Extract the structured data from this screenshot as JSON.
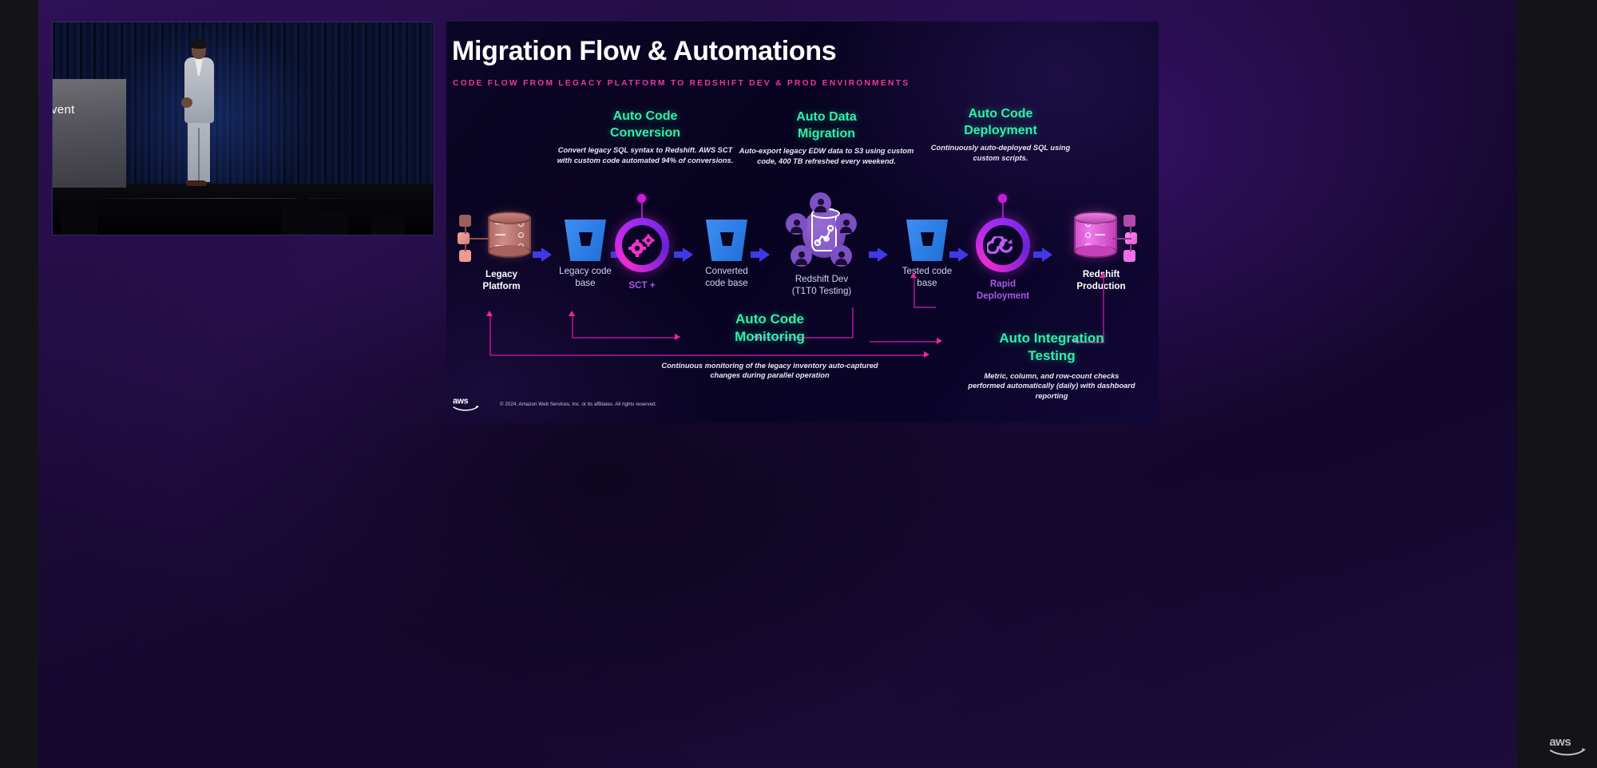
{
  "slide": {
    "title": "Migration Flow & Automations",
    "subtitle": "CODE FLOW FROM LEGACY PLATFORM TO REDSHIFT DEV & PROD ENVIRONMENTS",
    "footer": {
      "brand": "aws",
      "copyright": "© 2024, Amazon Web Services, Inc. or its affiliates. All rights reserved."
    }
  },
  "video": {
    "podium_text": "vent"
  },
  "watermark": {
    "brand": "aws"
  },
  "blocks": [
    {
      "id": "auto-code-conversion",
      "heading_line1": "Auto Code",
      "heading_line2": "Conversion",
      "description": "Convert legacy SQL syntax to Redshift. AWS SCT with custom code automated 94% of conversions.",
      "color": "#2ff0a8"
    },
    {
      "id": "auto-data-migration",
      "heading_line1": "Auto Data",
      "heading_line2": "Migration",
      "description": "Auto-export legacy EDW data to S3 using custom code, 400 TB refreshed every weekend.",
      "color": "#2ff0a8"
    },
    {
      "id": "auto-code-deployment",
      "heading_line1": "Auto Code",
      "heading_line2": "Deployment",
      "description": "Continuously auto-deployed SQL using custom scripts.",
      "color": "#2ff0a8"
    },
    {
      "id": "auto-code-monitoring",
      "heading_line1": "Auto Code",
      "heading_line2": "Monitoring",
      "description": "Continuous monitoring of the legacy inventory auto-captured changes during parallel operation",
      "color": "#2ff0a8"
    },
    {
      "id": "auto-integration-testing",
      "heading_line1": "Auto Integration",
      "heading_line2": "Testing",
      "description": "Metric, column, and row-count checks performed automatically (daily) with dashboard reporting",
      "color": "#2ff0a8"
    }
  ],
  "flow": {
    "nodes": [
      {
        "id": "legacy-platform",
        "label_line1": "Legacy",
        "label_line2": "Platform",
        "icon": "database-icon",
        "style": "white"
      },
      {
        "id": "legacy-code-base",
        "label_line1": "Legacy code",
        "label_line2": "base",
        "icon": "code-bucket-icon",
        "style": "muted"
      },
      {
        "id": "sct-plus",
        "label_line1": "SCT +",
        "label_line2": "",
        "icon": "gears-ring-icon",
        "style": "purple"
      },
      {
        "id": "converted-code-base",
        "label_line1": "Converted",
        "label_line2": "code base",
        "icon": "code-bucket-icon",
        "style": "muted"
      },
      {
        "id": "redshift-dev",
        "label_line1": "Redshift Dev",
        "label_line2": "(T1T0 Testing)",
        "icon": "cluster-users-icon",
        "style": "muted"
      },
      {
        "id": "tested-code-base",
        "label_line1": "Tested code",
        "label_line2": "base",
        "icon": "code-bucket-icon",
        "style": "muted"
      },
      {
        "id": "rapid-deployment",
        "label_line1": "Rapid",
        "label_line2": "Deployment",
        "icon": "infinity-ring-icon",
        "style": "purple"
      },
      {
        "id": "redshift-production",
        "label_line1": "Redshift",
        "label_line2": "Production",
        "icon": "database-icon",
        "style": "white"
      }
    ],
    "arrow_color": "#4338e8",
    "connector_color": "#f0269e"
  },
  "colors": {
    "accent_green": "#2ff0a8",
    "accent_pink": "#f0359e",
    "accent_purple": "#a758e8",
    "slide_bg": "#0a0426",
    "page_bg": "#141418"
  }
}
